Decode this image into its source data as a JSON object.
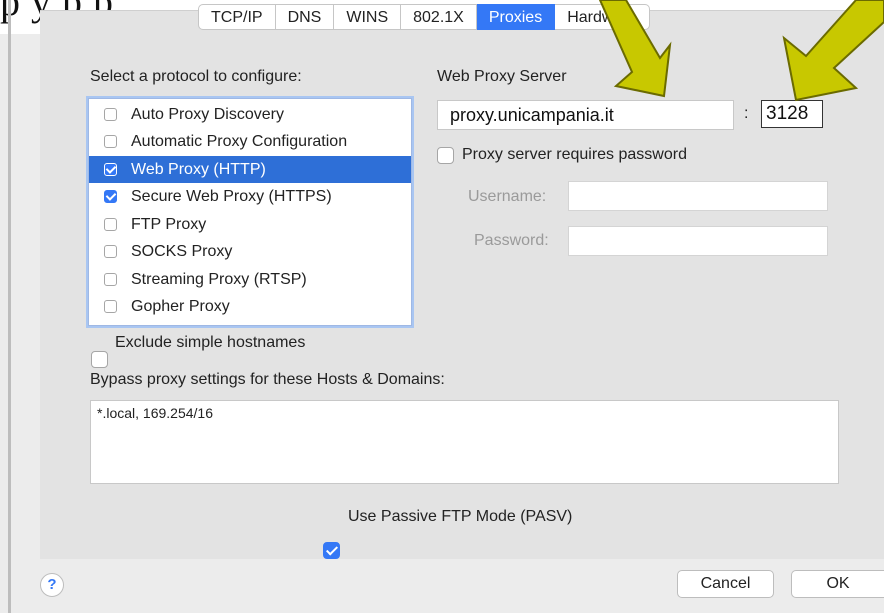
{
  "document_fragment": "p   y   p   p",
  "tabs": [
    {
      "label": "TCP/IP",
      "active": false
    },
    {
      "label": "DNS",
      "active": false
    },
    {
      "label": "WINS",
      "active": false
    },
    {
      "label": "802.1X",
      "active": false
    },
    {
      "label": "Proxies",
      "active": true
    },
    {
      "label": "Hardware",
      "active": false
    }
  ],
  "protocol_section": {
    "label": "Select a protocol to configure:",
    "items": [
      {
        "label": "Auto Proxy Discovery",
        "checked": false,
        "selected": false
      },
      {
        "label": "Automatic Proxy Configuration",
        "checked": false,
        "selected": false
      },
      {
        "label": "Web Proxy (HTTP)",
        "checked": true,
        "selected": true
      },
      {
        "label": "Secure Web Proxy (HTTPS)",
        "checked": true,
        "selected": false
      },
      {
        "label": "FTP Proxy",
        "checked": false,
        "selected": false
      },
      {
        "label": "SOCKS Proxy",
        "checked": false,
        "selected": false
      },
      {
        "label": "Streaming Proxy (RTSP)",
        "checked": false,
        "selected": false
      },
      {
        "label": "Gopher Proxy",
        "checked": false,
        "selected": false
      }
    ]
  },
  "server": {
    "label": "Web Proxy Server",
    "host": "proxy.unicampania.it",
    "separator": ":",
    "port": "3128",
    "requires_password_label": "Proxy server requires password",
    "requires_password": false,
    "username_label": "Username:",
    "password_label": "Password:"
  },
  "exclude_simple_hostnames": {
    "label": "Exclude simple hostnames",
    "checked": false
  },
  "bypass": {
    "label": "Bypass proxy settings for these Hosts & Domains:",
    "value": "*.local, 169.254/16"
  },
  "passive_ftp": {
    "label": "Use Passive FTP Mode (PASV)",
    "checked": true
  },
  "buttons": {
    "help": "?",
    "cancel": "Cancel",
    "ok": "OK"
  },
  "colors": {
    "accent": "#3478f6",
    "selection": "#2e6fd7",
    "annotation_arrow": "#c8c800"
  },
  "icons": {
    "annotation": "arrow-down-left-icon"
  }
}
